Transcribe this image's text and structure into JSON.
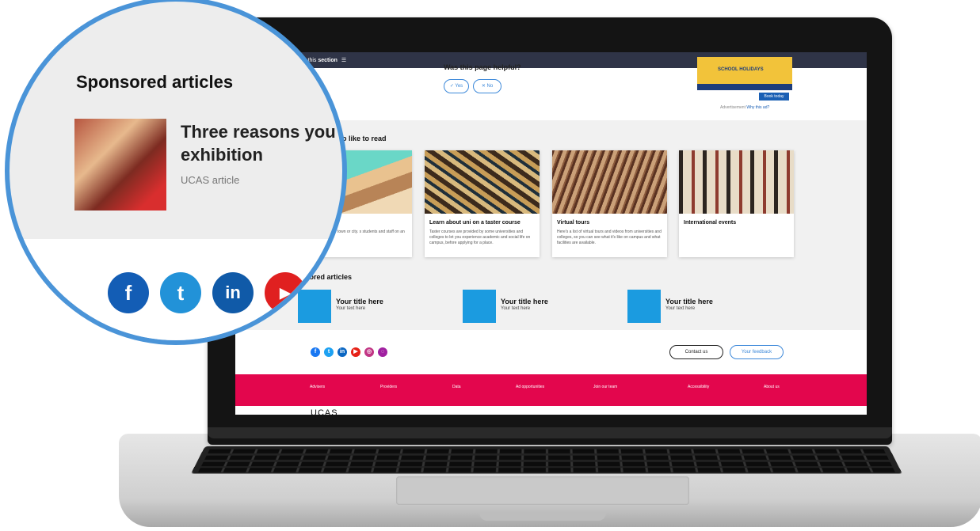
{
  "screen": {
    "topbar": {
      "explore_prefix": "plore this ",
      "explore_bold": "section",
      "menu_icon": "☰"
    },
    "helpful": {
      "question": "Was this page helpful?",
      "yes_label": "✓ Yes",
      "no_label": "✕ No"
    },
    "ad": {
      "headline": "SCHOOL HOLIDAYS",
      "book_label": "Book today",
      "caption": "Advertisement",
      "why_link": "Why this ad?"
    },
    "also_like_title": "o like to read",
    "cards": [
      {
        "title": "s",
        "text": "ny, the facilities, the town or city. s students and staff on an open"
      },
      {
        "title": "Learn about uni on a taster course",
        "text": "Taster courses are provided by some universities and colleges to let you experience academic and social life on campus, before applying for a place."
      },
      {
        "title": "Virtual tours",
        "text": "Here's a list of virtual tours and videos from universities and colleges, so you can see what it's like on campus and what facilities are available."
      },
      {
        "title": "International events",
        "text": ""
      }
    ],
    "sponsored_title": "nsored articles",
    "sponsored": [
      {
        "title": "Your title here",
        "text": "Your text here"
      },
      {
        "title": "Your title here",
        "text": "Your text here"
      },
      {
        "title": "Your title here",
        "text": "Your text here"
      }
    ],
    "social_icons": [
      "facebook-icon",
      "twitter-icon",
      "linkedin-icon",
      "youtube-icon",
      "instagram-icon",
      "snapchat-icon"
    ],
    "contact_label": "Contact us",
    "feedback_label": "Your feedback",
    "footer_links": [
      "Advisers",
      "Providers",
      "Data",
      "Ad opportunities",
      "Join our team",
      "Accessibility",
      "About us"
    ],
    "logo": "UCAS"
  },
  "magnifier": {
    "title": "Sponsored articles",
    "article_title": "Three reasons you s exhibition",
    "article_sub": "UCAS article",
    "social_icons": [
      "facebook-icon",
      "twitter-icon",
      "linkedin-icon",
      "youtube-icon"
    ]
  },
  "colors": {
    "accent_blue": "#4a94d8",
    "footer_red": "#e3064d",
    "nav_dark": "#2f3447",
    "sponsored_box": "#1b9be0"
  }
}
